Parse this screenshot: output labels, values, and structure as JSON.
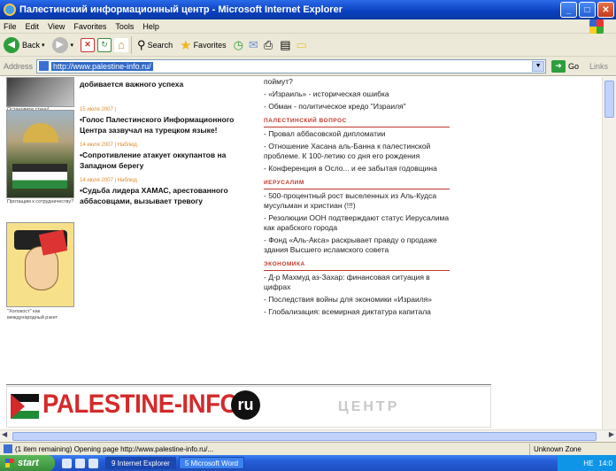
{
  "window": {
    "title": "Палестинский информационный центр - Microsoft Internet Explorer",
    "minimize": "_",
    "maximize": "□",
    "close": "✕"
  },
  "menu": [
    "File",
    "Edit",
    "View",
    "Favorites",
    "Tools",
    "Help"
  ],
  "toolbar": {
    "back_label": "Back",
    "search_label": "Search",
    "favorites_label": "Favorites"
  },
  "address": {
    "label": "Address",
    "url": "http://www.palestine-info.ru/",
    "go_label": "Go",
    "links_label": "Links"
  },
  "left_captions": {
    "cap1": "Остановите стену!",
    "cap2": "Протащим к сотрудничеству?",
    "cap3": "\"Холокост\" как международный рэкет"
  },
  "middle": {
    "top_headline": "добивается важного успеха",
    "news": [
      {
        "meta": "15 июля 2007 |",
        "headline": "•Голос Палестинского Информационного Центра зазвучал на турецком языке!"
      },
      {
        "meta": "14 июля 2007 | Наблюд",
        "headline": "•Сопротивление атакует оккупантов на Западном берегу"
      },
      {
        "meta": "14 июля 2007 | Наблюд",
        "headline": "•Судьба лидера ХАМАС, арестованного аббасовцами, вызывает тревогу"
      }
    ]
  },
  "right": {
    "top_items": [
      "поймут?",
      "- «Израиль» - историческая ошибка",
      "- Обман - политическое кредо \"Израиля\""
    ],
    "sections": [
      {
        "title": "ПАЛЕСТИНСКИЙ ВОПРОС",
        "items": [
          "- Провал аббасовской дипломатии",
          "- Отношение Хасана аль-Банна к палестинской проблеме. К 100-летию со дня его рождения",
          "- Конференция в Осло... и ее забытая годовщина"
        ]
      },
      {
        "title": "ИЕРУСАЛИМ",
        "items": [
          "- 500-процентный рост выселенных из Аль-Кудса мусульман и христиан (!!!)",
          "- Резолюции ООН подтверждают статус Иерусалима как арабского города",
          "- Фонд «Аль-Акса» раскрывает правду о продаже здания Высшего исламского совета"
        ]
      },
      {
        "title": "ЭКОНОМИКА",
        "items": [
          "- Д-р Махмуд аз-Захар: финансовая ситуация в цифрах",
          "- Последствия войны для экономики «Израиля»",
          "- Глобализация: всемирная диктатура капитала"
        ]
      }
    ]
  },
  "banner": {
    "brand": "PALESTINE-INFO.",
    "ru": "ru",
    "centr": "ЦЕНТР"
  },
  "status": {
    "text": "(1 item remaining) Opening page http://www.palestine-info.ru/...",
    "zone": "Unknown Zone"
  },
  "taskbar": {
    "start": "start",
    "tasks": [
      "9 Internet Explorer",
      "5 Microsoft Word"
    ],
    "lang": "HE",
    "clock": "14:0"
  },
  "colors": {
    "accent_red": "#d42a2a",
    "section_red": "#c0392b",
    "meta_orange": "#e08a2a",
    "xp_blue": "#245dd7"
  }
}
